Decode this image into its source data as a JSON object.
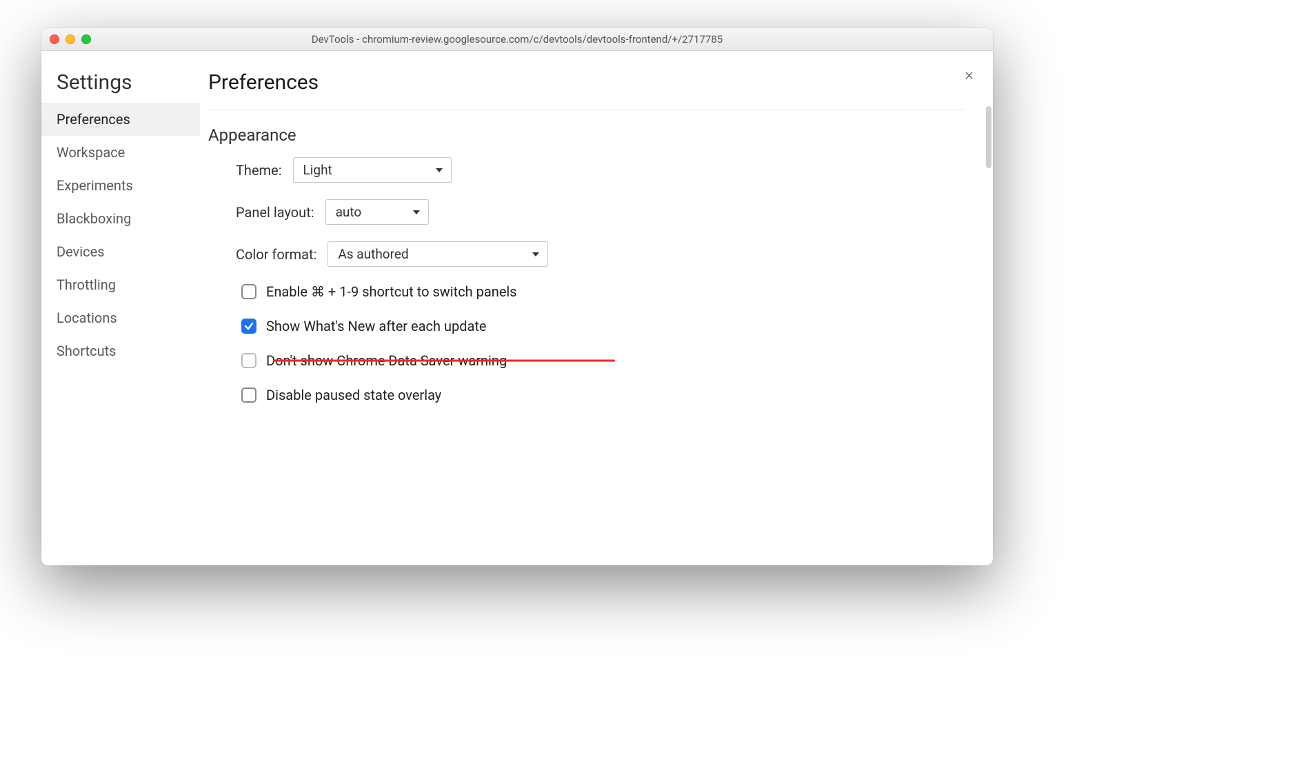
{
  "window": {
    "title": "DevTools - chromium-review.googlesource.com/c/devtools/devtools-frontend/+/2717785"
  },
  "close_label": "×",
  "sidebar": {
    "heading": "Settings",
    "items": [
      {
        "label": "Preferences",
        "selected": true
      },
      {
        "label": "Workspace"
      },
      {
        "label": "Experiments"
      },
      {
        "label": "Blackboxing"
      },
      {
        "label": "Devices"
      },
      {
        "label": "Throttling"
      },
      {
        "label": "Locations"
      },
      {
        "label": "Shortcuts"
      }
    ]
  },
  "main": {
    "heading": "Preferences",
    "appearance": {
      "title": "Appearance",
      "theme": {
        "label": "Theme:",
        "value": "Light"
      },
      "panel_layout": {
        "label": "Panel layout:",
        "value": "auto"
      },
      "color_format": {
        "label": "Color format:",
        "value": "As authored"
      },
      "checkboxes": [
        {
          "label": "Enable ⌘ + 1-9 shortcut to switch panels",
          "checked": false,
          "struck": false
        },
        {
          "label": "Show What's New after each update",
          "checked": true,
          "struck": false
        },
        {
          "label": "Don't show Chrome Data Saver warning",
          "checked": false,
          "struck": true
        },
        {
          "label": "Disable paused state overlay",
          "checked": false,
          "struck": false
        }
      ]
    }
  }
}
